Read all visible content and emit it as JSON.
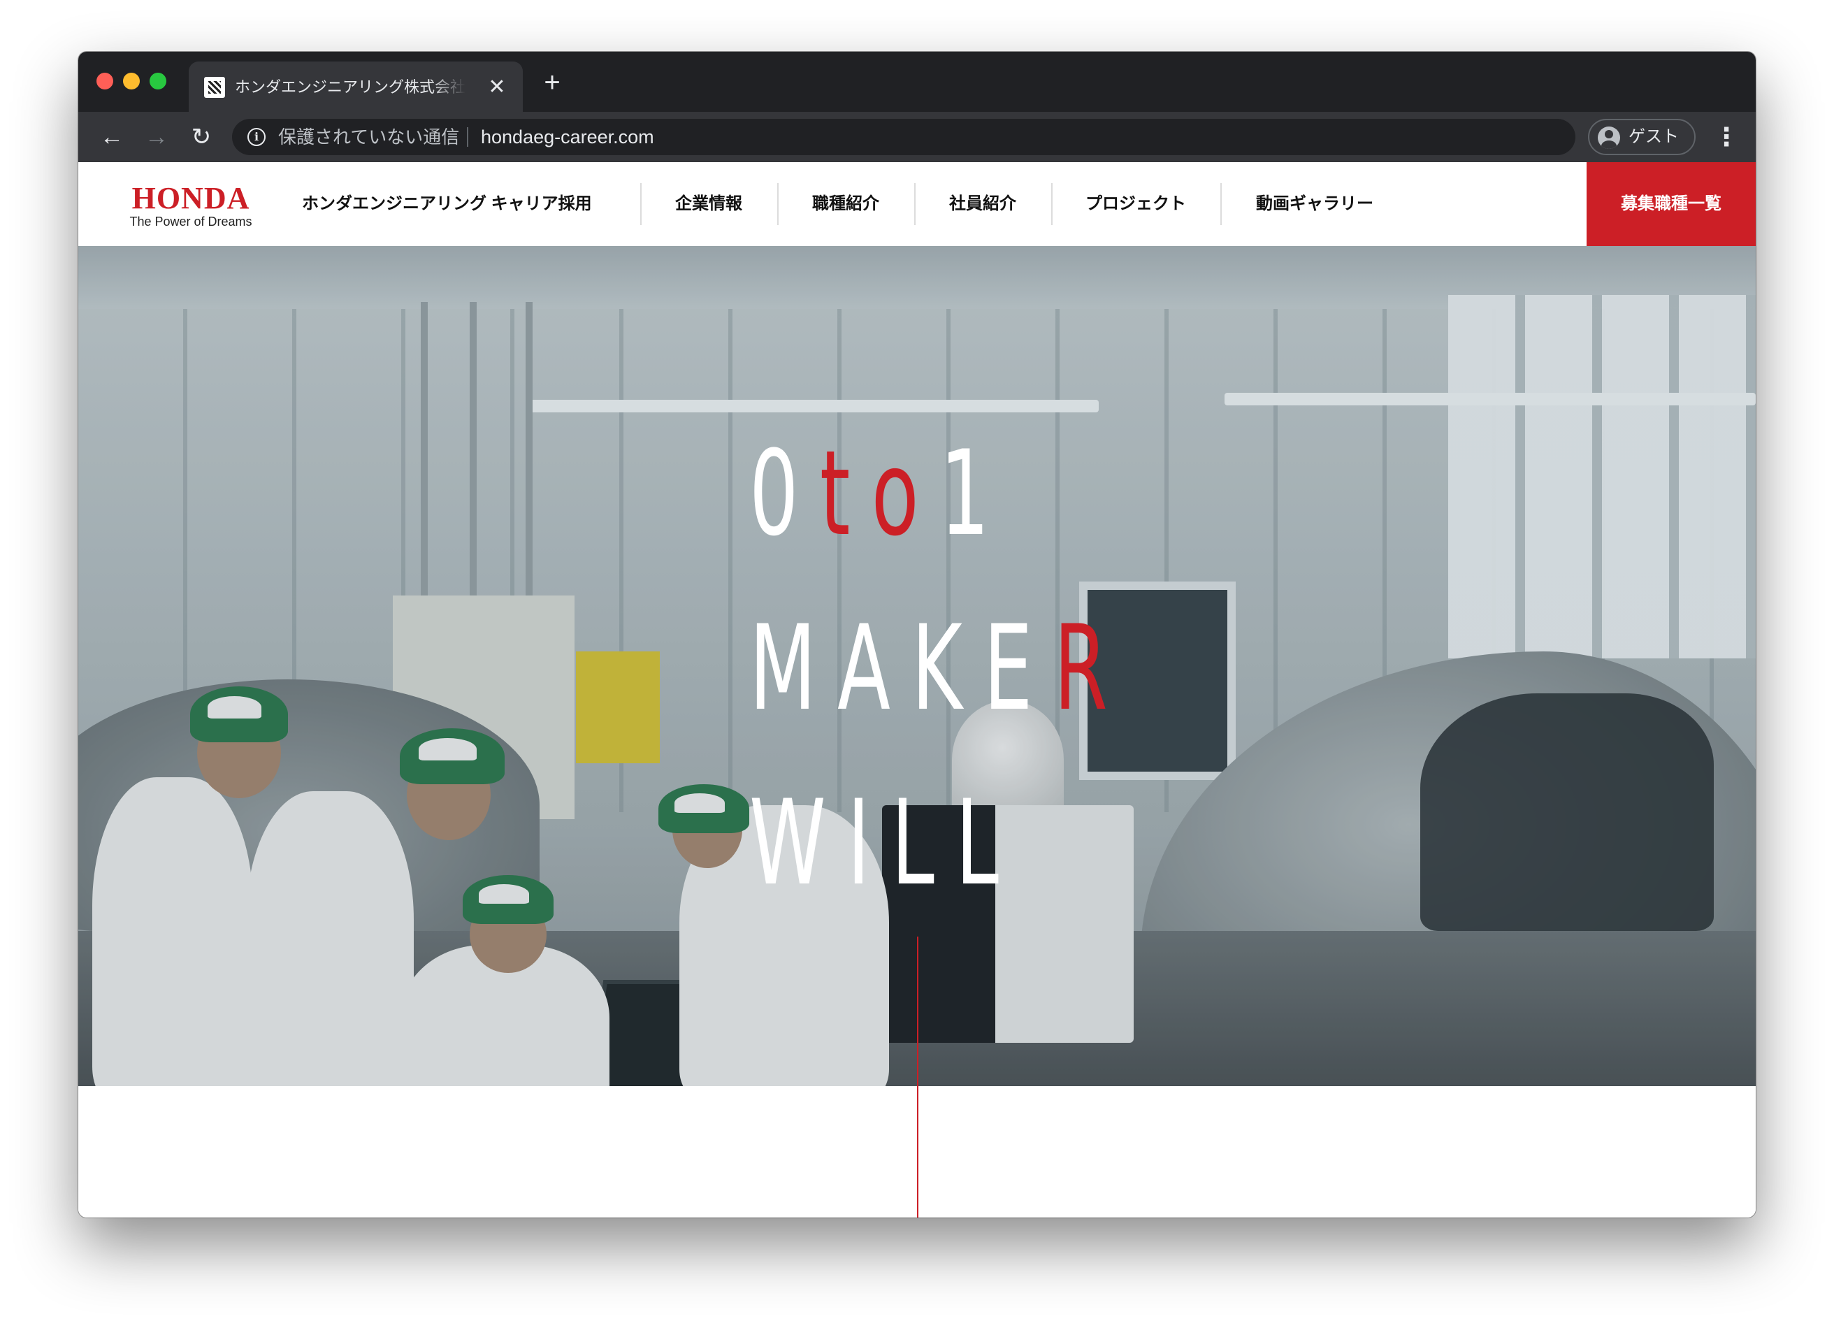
{
  "browser": {
    "tab": {
      "title": "ホンダエンジニアリング株式会社 キャリア採用",
      "close_glyph": "✕",
      "new_tab_glyph": "+"
    },
    "nav": {
      "back_glyph": "←",
      "forward_glyph": "→",
      "reload_glyph": "↻"
    },
    "omnibox": {
      "security_label": "保護されていない通信",
      "url": "hondaeg-career.com",
      "info_glyph": "i"
    },
    "profile": {
      "label": "ゲスト"
    },
    "menu_glyph": "⋮"
  },
  "site": {
    "logo": {
      "word": "HONDA",
      "tagline": "The Power of Dreams"
    },
    "title": "ホンダエンジニアリング キャリア採用",
    "nav": [
      {
        "label": "企業情報"
      },
      {
        "label": "職種紹介"
      },
      {
        "label": "社員紹介"
      },
      {
        "label": "プロジェクト"
      },
      {
        "label": "動画ギャラリー"
      }
    ],
    "cta_label": "募集職種一覧",
    "accent_color": "#cc1f26"
  },
  "hero": {
    "line1": {
      "a": "0",
      "b": "to",
      "c": "1"
    },
    "line2": {
      "a": "MAKE",
      "b": "R"
    },
    "line3": "WILL"
  }
}
